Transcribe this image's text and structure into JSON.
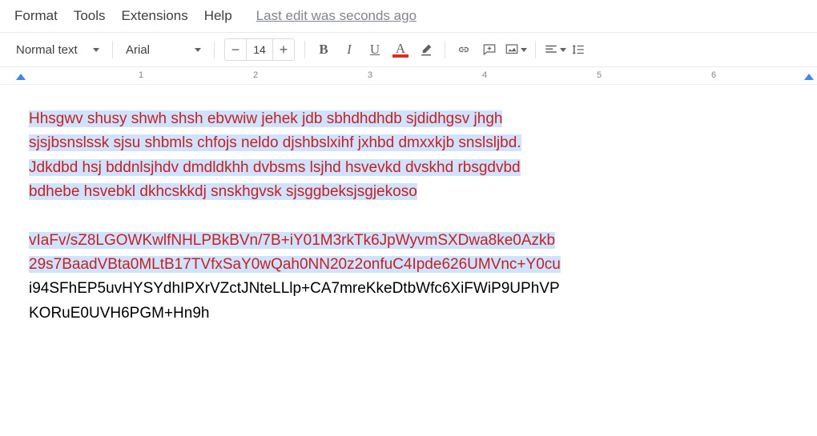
{
  "menu": {
    "format": "Format",
    "tools": "Tools",
    "extensions": "Extensions",
    "help": "Help",
    "edit_status": "Last edit was seconds ago"
  },
  "toolbar": {
    "style_label": "Normal text",
    "font_label": "Arial",
    "font_size": "14",
    "bold": "B",
    "italic": "I",
    "underline": "U",
    "text_color_letter": "A",
    "text_color_swatch": "#d93025"
  },
  "ruler": {
    "ticks": [
      "1",
      "2",
      "3",
      "4",
      "5",
      "6"
    ]
  },
  "doc": {
    "p1_line1": "Hhsgwv shusy shwh shsh ebvwiw jehek jdb sbhdhdhdb sjdidhgsv jhgh",
    "p1_line2": "sjsjbsnslssk sjsu shbmls chfojs neldo djshbslxihf jxhbd dmxxkjb snslsljbd.",
    "p1_line3": "Jdkdbd hsj bddnlsjhdv dmdldkhh dvbsms lsjhd hsvevkd dvskhd rbsgdvbd",
    "p1_line4": "bdhebe hsvebkl dkhcskkdj snskhgvsk sjsggbeksjsgjekoso",
    "p2_line1": "vIaFv/sZ8LGOWKwlfNHLPBkBVn/7B+iY01M3rkTk6JpWyvmSXDwa8ke0Azkb",
    "p2_line2": "29s7BaadVBta0MLtB17TVfxSaY0wQah0NN20z2onfuC4Ipde626UMVnc+Y0cu",
    "p3_line1": "i94SFhEP5uvHYSYdhIPXrVZctJNteLLlp+CA7mreKkeDtbWfc6XiFWiP9UPhVP",
    "p3_line2": "KORuE0UVH6PGM+Hn9h"
  }
}
